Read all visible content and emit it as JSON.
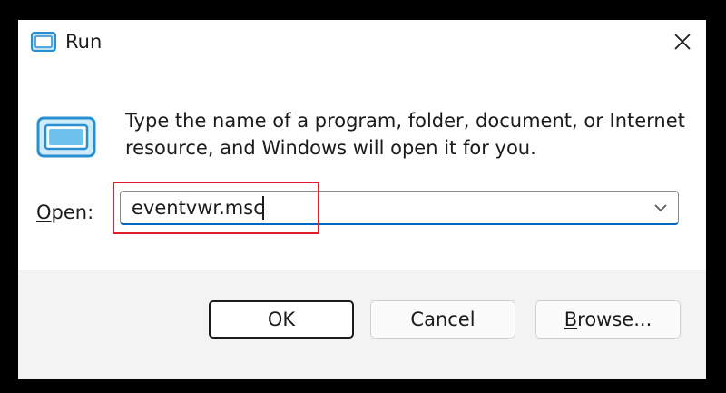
{
  "window": {
    "title": "Run",
    "close_icon": "close-icon",
    "app_icon": "run-app-icon"
  },
  "content": {
    "description": "Type the name of a program, folder, document, or Internet resource, and Windows will open it for you.",
    "open_label_mnemonic": "O",
    "open_label_rest": "pen:",
    "combo_value": "eventvwr.msc",
    "combo_arrow_icon": "chevron-down-icon"
  },
  "buttons": {
    "ok_label": "OK",
    "cancel_label": "Cancel",
    "browse_mnemonic": "B",
    "browse_rest": "rowse..."
  },
  "colors": {
    "accent": "#0067c0",
    "highlight": "#e0202a",
    "icon_blue": "#3aa0e0"
  }
}
